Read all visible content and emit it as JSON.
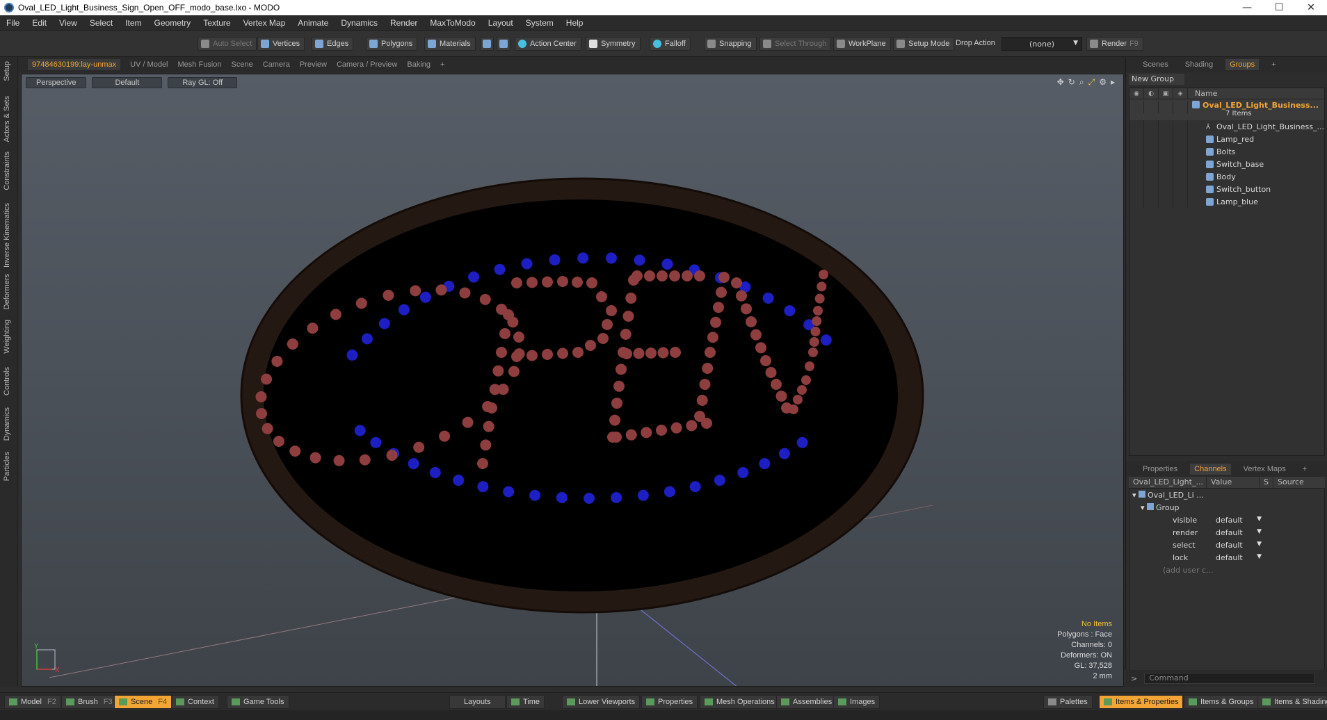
{
  "window": {
    "title": "Oval_LED_Light_Business_Sign_Open_OFF_modo_base.lxo - MODO",
    "min": "—",
    "max": "☐",
    "close": "✕"
  },
  "menu": [
    "File",
    "Edit",
    "View",
    "Select",
    "Item",
    "Geometry",
    "Texture",
    "Vertex Map",
    "Animate",
    "Dynamics",
    "Render",
    "MaxToModo",
    "Layout",
    "System",
    "Help"
  ],
  "toolbar": {
    "auto_select": "Auto Select",
    "vertices": "Vertices",
    "edges": "Edges",
    "polygons": "Polygons",
    "materials": "Materials",
    "action_center": "Action Center",
    "symmetry": "Symmetry",
    "falloff": "Falloff",
    "snapping": "Snapping",
    "select_through": "Select Through",
    "workplane": "WorkPlane",
    "setup_mode": "Setup Mode",
    "drop_action": "Drop Action",
    "drop_value": "(none)",
    "render": "Render",
    "render_key": "F9"
  },
  "left_tabs": [
    "Setup",
    "Actors & Sets",
    "Constraints",
    "Inverse Kinematics",
    "Deformers",
    "Weighting",
    "Controls",
    "Dynamics",
    "Particles"
  ],
  "viewport_tabs": [
    {
      "label": "97484630199:lay-unmax",
      "active": true
    },
    {
      "label": "UV / Model",
      "active": false
    },
    {
      "label": "Mesh Fusion",
      "active": false
    },
    {
      "label": "Scene",
      "active": false
    },
    {
      "label": "Camera",
      "active": false
    },
    {
      "label": "Preview",
      "active": false
    },
    {
      "label": "Camera / Preview",
      "active": false
    },
    {
      "label": "Baking",
      "active": false
    },
    {
      "label": "+",
      "active": false
    }
  ],
  "viewport": {
    "view": "Perspective",
    "shading": "Default",
    "raygl": "Ray GL: Off",
    "info": {
      "selection": "No Items",
      "polygons": "Polygons : Face",
      "channels": "Channels: 0",
      "deformers": "Deformers: ON",
      "gl": "GL: 37,528",
      "grid": "2 mm"
    },
    "axis_x": "X",
    "axis_y": "Y",
    "sign_colors": {
      "frame": "#241812",
      "face": "#000000",
      "red_led": "#8e3e3e",
      "blue_led": "#1d1fc2"
    }
  },
  "right_panel": {
    "top_tabs": [
      {
        "label": "Scenes",
        "active": false
      },
      {
        "label": "Shading",
        "active": false
      },
      {
        "label": "Groups",
        "active": true
      },
      {
        "label": "+",
        "active": false
      }
    ],
    "new_group": "New Group",
    "tree_header": "Name",
    "group": {
      "name": "Oval_LED_Light_Business...",
      "count": "7 Items"
    },
    "items": [
      "Oval_LED_Light_Business_...",
      "Lamp_red",
      "Bolts",
      "Switch_base",
      "Body",
      "Switch_button",
      "Lamp_blue"
    ],
    "bottom_tabs": [
      {
        "label": "Properties",
        "active": false
      },
      {
        "label": "Channels",
        "active": true
      },
      {
        "label": "Vertex Maps",
        "active": false
      },
      {
        "label": "+",
        "active": false
      }
    ],
    "channels": {
      "col_name": "Oval_LED_Light_...",
      "col_value": "Value",
      "col_s": "S",
      "col_source": "Source",
      "item": "Oval_LED_Li ...",
      "group": "Group",
      "rows": [
        {
          "name": "visible",
          "value": "default"
        },
        {
          "name": "render",
          "value": "default"
        },
        {
          "name": "select",
          "value": "default"
        },
        {
          "name": "lock",
          "value": "default"
        }
      ],
      "add_user": "(add user c..."
    },
    "command_placeholder": "Command"
  },
  "bottom_bar": {
    "model": "Model",
    "model_key": "F2",
    "brush": "Brush",
    "brush_key": "F3",
    "scene": "Scene",
    "scene_key": "F4",
    "context": "Context",
    "game_tools": "Game Tools",
    "layouts": "Layouts",
    "time": "Time",
    "lower_viewports": "Lower Viewports",
    "properties": "Properties",
    "mesh_operations": "Mesh Operations",
    "assemblies": "Assemblies",
    "images": "Images",
    "palettes": "Palettes",
    "items_properties": "Items & Properties",
    "items_groups": "Items & Groups",
    "items_shading": "Items & Shading"
  }
}
